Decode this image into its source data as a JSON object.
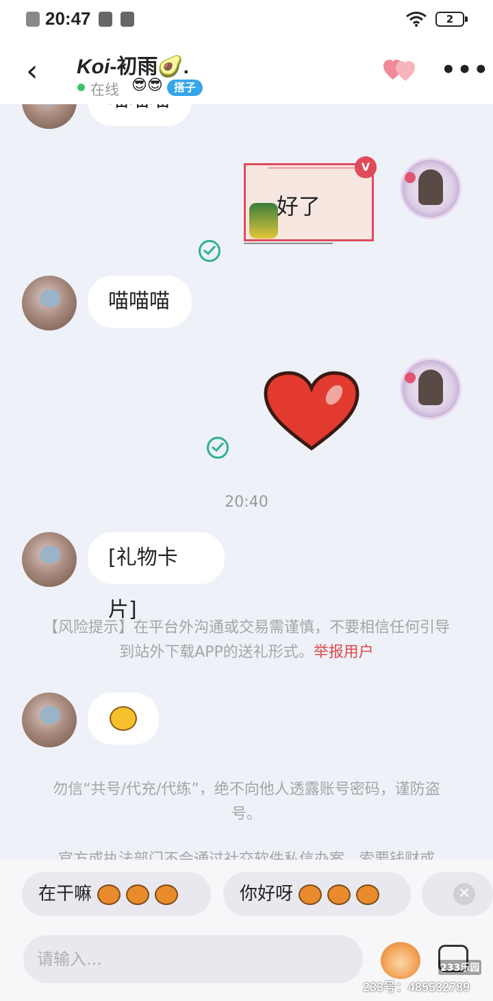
{
  "status_bar": {
    "time": "20:47",
    "battery": "2"
  },
  "header": {
    "title_italic": "Koi",
    "title_rest": "-初雨🥑.",
    "online_text": "在线",
    "badge_emoji": "😎😎",
    "badge_label": "搭子",
    "back_icon": "chevron-left-icon",
    "more_icon": "more-dots-icon",
    "accent": "#35a6e8"
  },
  "messages": [
    {
      "side": "left",
      "text": "喵喵喵"
    },
    {
      "side": "right",
      "type": "gift-card",
      "text": "好了",
      "read": true
    },
    {
      "side": "left",
      "text": "喵喵喵"
    },
    {
      "side": "right",
      "type": "heart-sticker",
      "read": true
    },
    {
      "type": "timestamp",
      "text": "20:40"
    },
    {
      "side": "left",
      "text": "[礼物卡片]"
    },
    {
      "type": "notice",
      "text": "【风险提示】在平台外沟通或交易需谨慎，不要相信任何引导到站外下载APP的送礼形式。",
      "link": "举报用户"
    },
    {
      "side": "left",
      "type": "emoji"
    },
    {
      "type": "notice",
      "text": "勿信“共号/代充/代练”，绝不向他人透露账号密码，谨防盗号。"
    },
    {
      "type": "notice",
      "text": "官方或执法部门不会通过社交软件私信办案，索要钱财或"
    }
  ],
  "quick_replies": [
    {
      "label": "在干嘛"
    },
    {
      "label": "你好呀"
    }
  ],
  "input": {
    "placeholder": "请输入..."
  },
  "watermark": {
    "logo": "233乐园",
    "text": "233号：485532789"
  },
  "colors": {
    "report_link": "#e04a4a",
    "read_check": "#2db28a",
    "background": "#eef1f8"
  }
}
